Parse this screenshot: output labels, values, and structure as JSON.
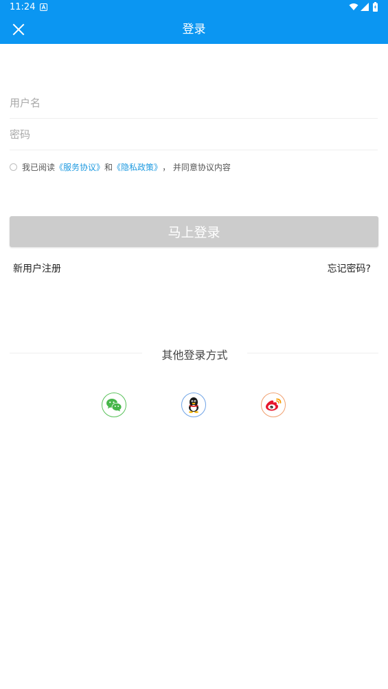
{
  "status_bar": {
    "time": "11:24",
    "icons": [
      "app-a-icon",
      "wifi-icon",
      "signal-icon",
      "battery-icon"
    ]
  },
  "header": {
    "title": "登录",
    "close_icon": "close-icon",
    "background": "#0b96f2"
  },
  "form": {
    "username_placeholder": "用户名",
    "password_placeholder": "密码"
  },
  "agreement": {
    "prefix": "我已阅读",
    "terms_link": "《服务协议》",
    "and": "和",
    "privacy_link": "《隐私政策》",
    "suffix": "，  并同意协议内容"
  },
  "login_button": {
    "label": "马上登录",
    "color": "#cccccc"
  },
  "links": {
    "register": "新用户注册",
    "forgot": "忘记密码?"
  },
  "other_login": {
    "title": "其他登录方式",
    "providers": [
      "wechat-icon",
      "qq-icon",
      "weibo-icon"
    ]
  }
}
